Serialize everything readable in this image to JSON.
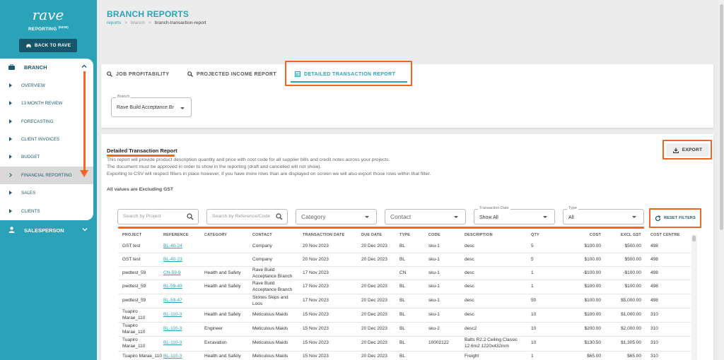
{
  "sidebar": {
    "logo_text": "rave",
    "subtitle": "REPORTING",
    "subtitle_sup": "(NEW)",
    "back_label": "BACK TO RAVE",
    "branch_label": "BRANCH",
    "items": [
      {
        "label": "OVERVIEW"
      },
      {
        "label": "13 MONTH REVIEW"
      },
      {
        "label": "FORECASTING"
      },
      {
        "label": "CLIENT INVOICES"
      },
      {
        "label": "BUDGET"
      },
      {
        "label": "FINANCIAL REPORTING"
      },
      {
        "label": "SALES"
      },
      {
        "label": "CLIENTS"
      }
    ],
    "salesperson_label": "SALESPERSON"
  },
  "header": {
    "title": "BRANCH REPORTS",
    "breadcrumb": [
      "reports",
      "branch",
      "branch-transaction-report"
    ],
    "breadcrumb_sep": ">"
  },
  "tabs": [
    {
      "label": "JOB PROFITABILITY",
      "icon": "search-icon"
    },
    {
      "label": "PROJECTED INCOME REPORT",
      "icon": "search-icon"
    },
    {
      "label": "DETAILED TRANSACTION REPORT",
      "icon": "table-icon"
    }
  ],
  "branch_select": {
    "legend": "Branch",
    "value": "Rave Build Acceptance Br"
  },
  "report": {
    "heading": "Detailed Transaction Report",
    "desc": [
      "This report will provide product description quantity and price with cost code for all supplier bills and credit notes across your projects.",
      "The document must be approved in order to show in the reporting (draft and cancelled will not show).",
      "Exporting to CSV will respect filters in place however, if you have more rows than are displayed on screen we will also export those rows within that filter."
    ],
    "gst_note": "All values are Excluding GST",
    "export_label": "EXPORT"
  },
  "filters": {
    "project_placeholder": "Search by Project",
    "reference_placeholder": "Search by Reference/Code",
    "category_placeholder": "Category",
    "contact_placeholder": "Contact",
    "date_legend": "Transaction Date",
    "date_value": "Show All",
    "type_legend": "Type",
    "type_value": "All",
    "reset_label": "RESET FILTERS"
  },
  "table": {
    "headers": [
      "PROJECT",
      "REFERENCE",
      "CATEGORY",
      "CONTACT",
      "TRANSACTION DATE",
      "DUE DATE",
      "TYPE",
      "CODE",
      "DESCRIPTION",
      "QTY",
      "COST",
      "EXCL GST",
      "COST CENTRE"
    ],
    "rows": [
      {
        "project": "GST test",
        "reference": "BL-40-24",
        "category": "",
        "contact": "Company",
        "tdate": "20 Nov 2023",
        "due": "20 Dec 2023",
        "type": "BL",
        "code": "sku-1",
        "desc": "desc",
        "qty": "5",
        "cost": "$100.00",
        "excl": "$500.00",
        "cc": "498"
      },
      {
        "project": "GST test",
        "reference": "BL-40-23",
        "category": "",
        "contact": "Company",
        "tdate": "20 Nov 2023",
        "due": "20 Dec 2023",
        "type": "BL",
        "code": "sku-1",
        "desc": "desc",
        "qty": "5",
        "cost": "$100.00",
        "excl": "$500.00",
        "cc": "498"
      },
      {
        "project": "pwdtest_59",
        "reference": "CN-59-9",
        "category": "Health and Safety",
        "contact": "Rave Build Acceptance Branch",
        "tdate": "17 Nov 2023",
        "due": "",
        "type": "CN",
        "code": "sku-1",
        "desc": "desc",
        "qty": "1",
        "cost": "-$100.00",
        "excl": "-$100.00",
        "cc": "498"
      },
      {
        "project": "pwdtest_59",
        "reference": "BL-59-49",
        "category": "Health and Safety",
        "contact": "Rave Build Acceptance Branch",
        "tdate": "17 Nov 2023",
        "due": "20 Dec 2023",
        "type": "BL",
        "code": "sku-1",
        "desc": "desc",
        "qty": "1",
        "cost": "$100.00",
        "excl": "$100.00",
        "cc": "498"
      },
      {
        "project": "pwdtest_59",
        "reference": "BL-59-47",
        "category": "",
        "contact": "Stones Skips and Loos",
        "tdate": "17 Nov 2023",
        "due": "20 Dec 2023",
        "type": "BL",
        "code": "sku-1",
        "desc": "desc",
        "qty": "50",
        "cost": "$100.00",
        "excl": "$5,000.00",
        "cc": "498"
      },
      {
        "project": "Tuapiro Marae_110",
        "reference": "BL-110-3",
        "category": "Health and Safety",
        "contact": "Meticulous Maids",
        "tdate": "15 Nov 2023",
        "due": "20 Dec 2023",
        "type": "BL",
        "code": "sku-1",
        "desc": "desc",
        "qty": "10",
        "cost": "$100.00",
        "excl": "$1,000.00",
        "cc": "310"
      },
      {
        "project": "Tuapiro Marae_110",
        "reference": "BL-110-3",
        "category": "Engineer",
        "contact": "Meticulous Maids",
        "tdate": "15 Nov 2023",
        "due": "20 Dec 2023",
        "type": "BL",
        "code": "sku-2",
        "desc": "desc2",
        "qty": "10",
        "cost": "$200.00",
        "excl": "$2,000.00",
        "cc": "310"
      },
      {
        "project": "Tuapiro Marae_110",
        "reference": "BL-110-3",
        "category": "Excavation",
        "contact": "Meticulous Maids",
        "tdate": "15 Nov 2023",
        "due": "20 Dec 2023",
        "type": "BL",
        "code": "10002122",
        "desc": "Batts R2.2 Ceiling Classic 12.6m2 1220x432mm",
        "qty": "10",
        "cost": "$130.50",
        "excl": "$1,305.00",
        "cc": "310"
      },
      {
        "project": "Tuapiro Marae_110",
        "reference": "BL-110-3",
        "category": "Health and Safety",
        "contact": "Meticulous Maids",
        "tdate": "15 Nov 2023",
        "due": "20 Dec 2023",
        "type": "BL",
        "code": "",
        "desc": "Freight",
        "qty": "1",
        "cost": "$65.00",
        "excl": "$65.00",
        "cc": "310"
      }
    ]
  },
  "colors": {
    "brand": "#2aa3b8",
    "dark": "#1a5b6e",
    "highlight": "#f26522"
  }
}
